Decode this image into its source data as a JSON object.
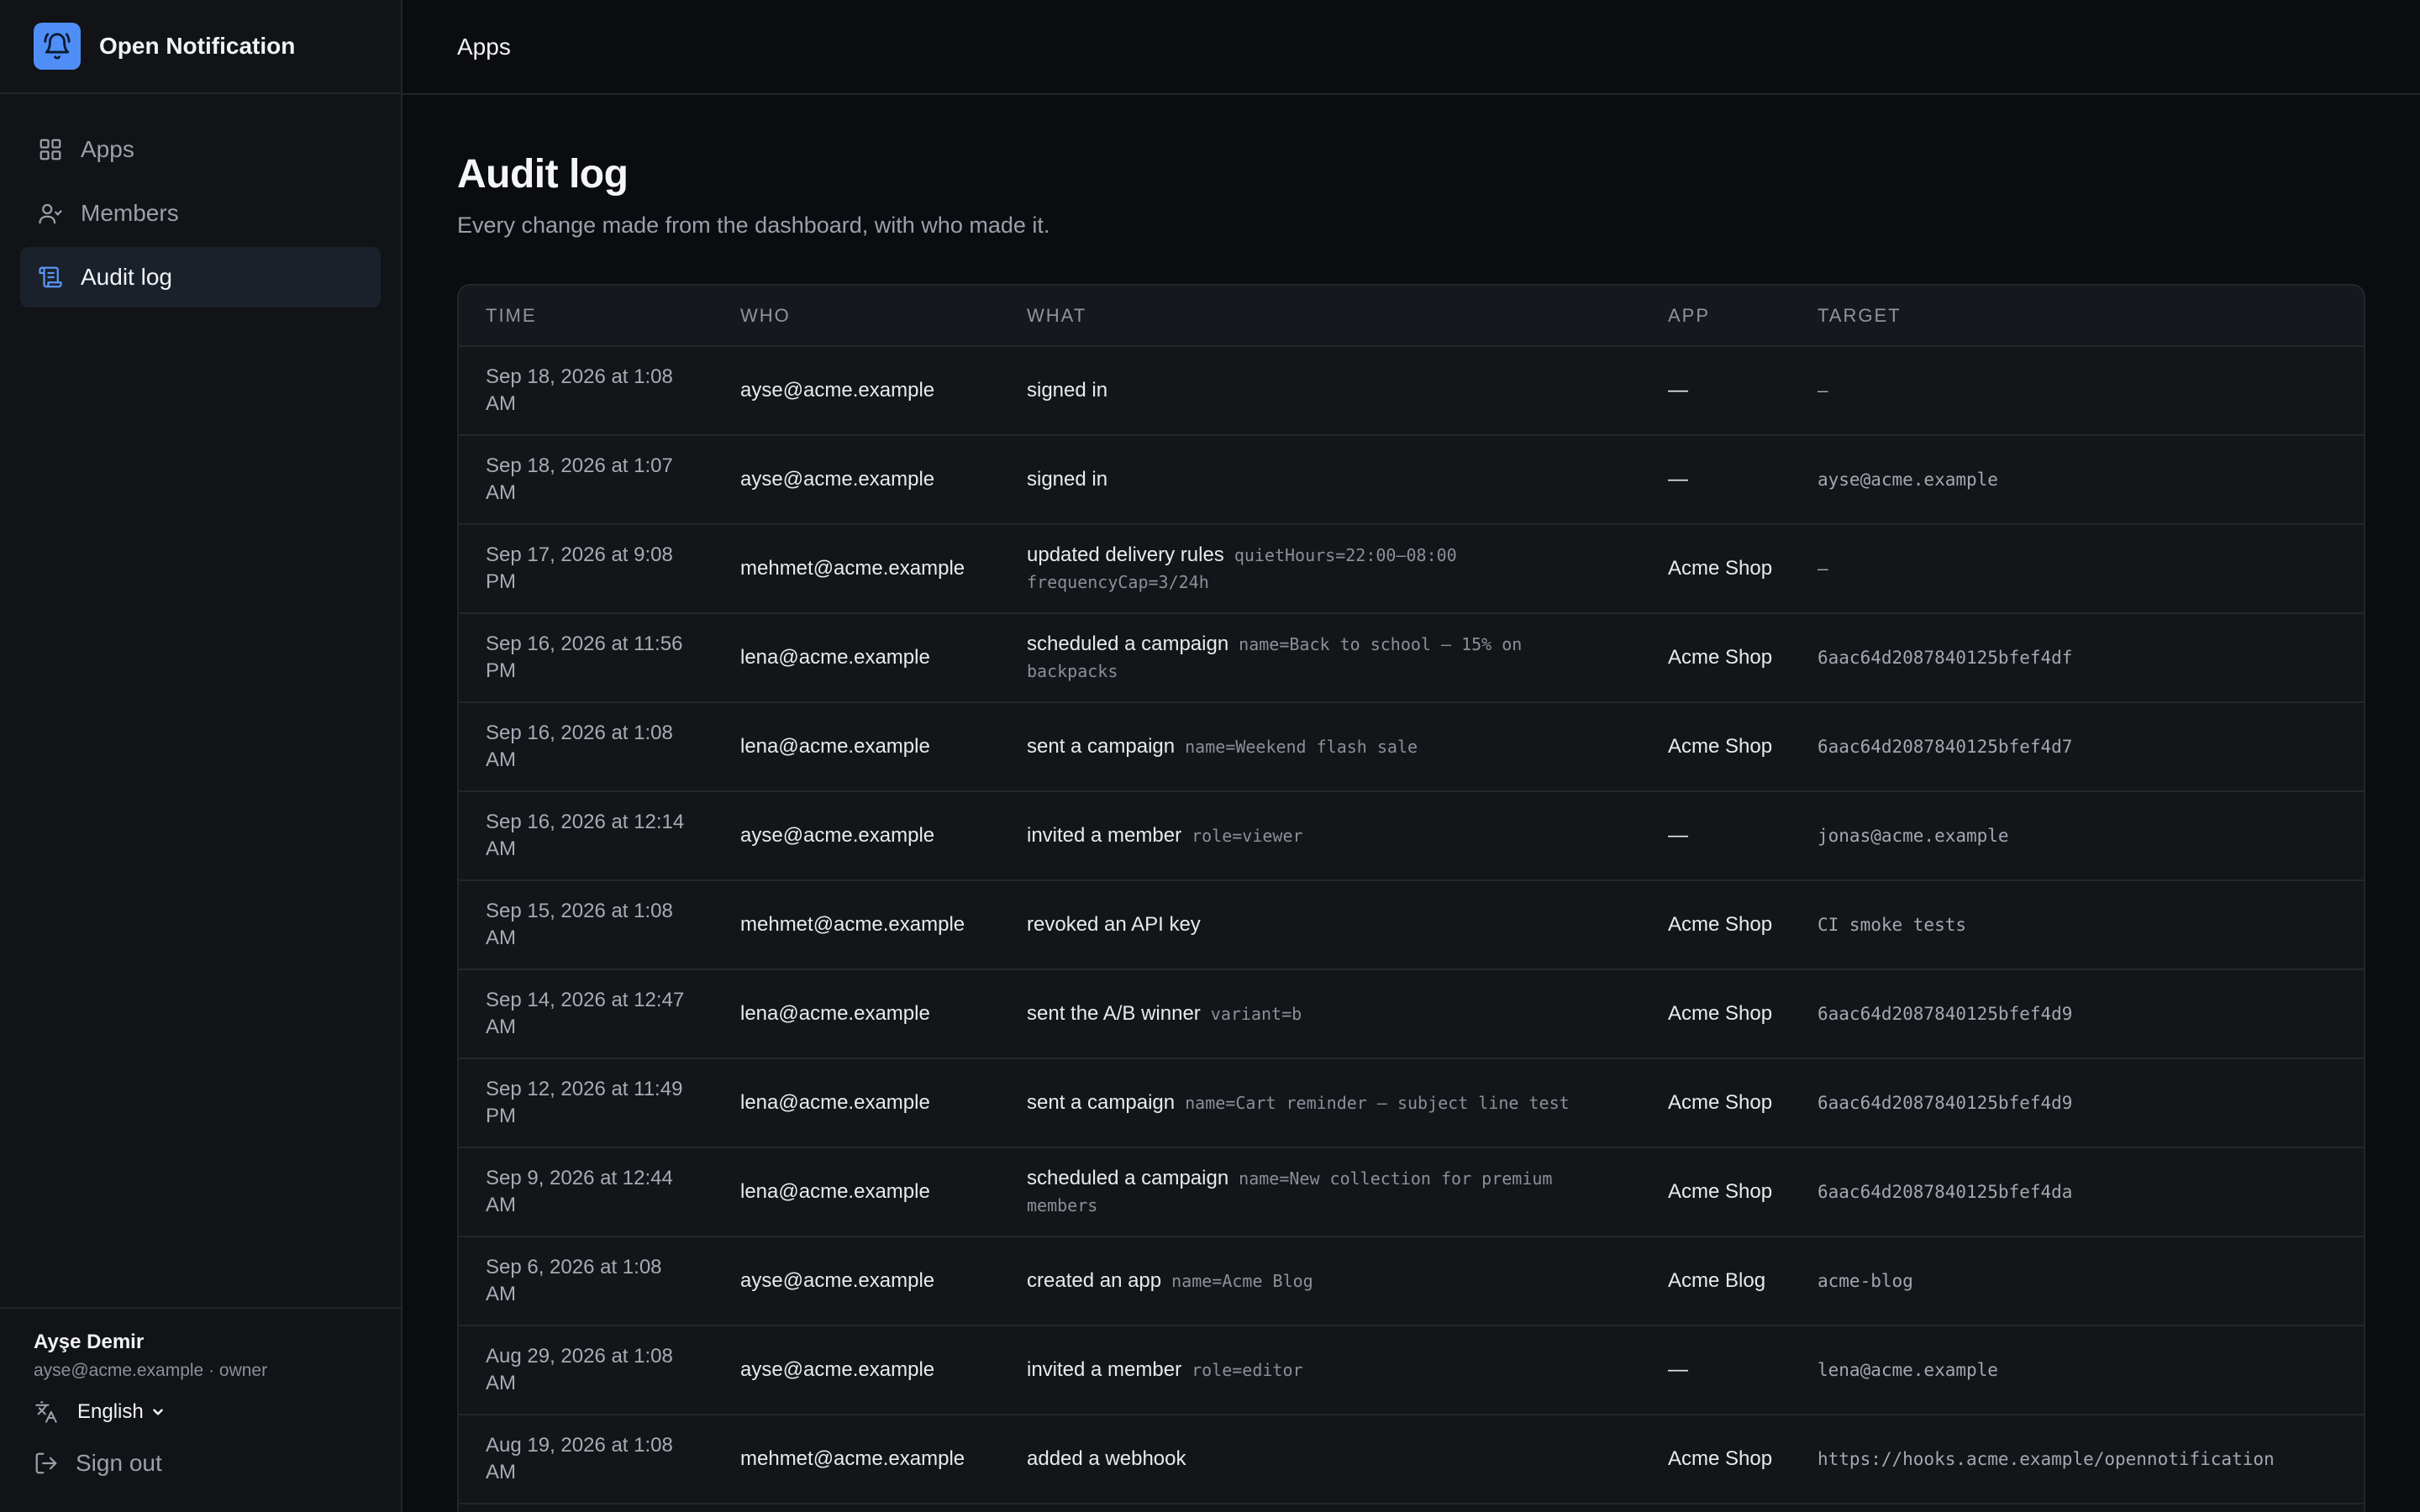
{
  "app": {
    "name": "Open Notification",
    "accent": "#4f8ef7"
  },
  "sidebar": {
    "items": [
      {
        "label": "Apps",
        "icon": "grid-icon",
        "active": false
      },
      {
        "label": "Members",
        "icon": "users-icon",
        "active": false
      },
      {
        "label": "Audit log",
        "icon": "scroll-icon",
        "active": true
      }
    ]
  },
  "user": {
    "name": "Ayşe Demir",
    "meta": "ayse@acme.example · owner"
  },
  "language": {
    "selected": "English"
  },
  "signout_label": "Sign out",
  "topbar": {
    "breadcrumb": "Apps"
  },
  "page": {
    "title": "Audit log",
    "subtitle": "Every change made from the dashboard, with who made it."
  },
  "table": {
    "columns": [
      "TIME",
      "WHO",
      "WHAT",
      "APP",
      "TARGET"
    ],
    "rows": [
      {
        "time": "Sep 18, 2026 at 1:08 AM",
        "who": "ayse@acme.example",
        "action": "signed in",
        "detail": "",
        "app": "—",
        "target": "—"
      },
      {
        "time": "Sep 18, 2026 at 1:07 AM",
        "who": "ayse@acme.example",
        "action": "signed in",
        "detail": "",
        "app": "—",
        "target": "ayse@acme.example"
      },
      {
        "time": "Sep 17, 2026 at 9:08 PM",
        "who": "mehmet@acme.example",
        "action": "updated delivery rules",
        "detail": "quietHours=22:00–08:00 frequencyCap=3/24h",
        "app": "Acme Shop",
        "target": "—"
      },
      {
        "time": "Sep 16, 2026 at 11:56 PM",
        "who": "lena@acme.example",
        "action": "scheduled a campaign",
        "detail": "name=Back to school — 15% on backpacks",
        "app": "Acme Shop",
        "target": "6aac64d2087840125bfef4df"
      },
      {
        "time": "Sep 16, 2026 at 1:08 AM",
        "who": "lena@acme.example",
        "action": "sent a campaign",
        "detail": "name=Weekend flash sale",
        "app": "Acme Shop",
        "target": "6aac64d2087840125bfef4d7"
      },
      {
        "time": "Sep 16, 2026 at 12:14 AM",
        "who": "ayse@acme.example",
        "action": "invited a member",
        "detail": "role=viewer",
        "app": "—",
        "target": "jonas@acme.example"
      },
      {
        "time": "Sep 15, 2026 at 1:08 AM",
        "who": "mehmet@acme.example",
        "action": "revoked an API key",
        "detail": "",
        "app": "Acme Shop",
        "target": "CI smoke tests"
      },
      {
        "time": "Sep 14, 2026 at 12:47 AM",
        "who": "lena@acme.example",
        "action": "sent the A/B winner",
        "detail": "variant=b",
        "app": "Acme Shop",
        "target": "6aac64d2087840125bfef4d9"
      },
      {
        "time": "Sep 12, 2026 at 11:49 PM",
        "who": "lena@acme.example",
        "action": "sent a campaign",
        "detail": "name=Cart reminder — subject line test",
        "app": "Acme Shop",
        "target": "6aac64d2087840125bfef4d9"
      },
      {
        "time": "Sep 9, 2026 at 12:44 AM",
        "who": "lena@acme.example",
        "action": "scheduled a campaign",
        "detail": "name=New collection for premium members",
        "app": "Acme Shop",
        "target": "6aac64d2087840125bfef4da"
      },
      {
        "time": "Sep 6, 2026 at 1:08 AM",
        "who": "ayse@acme.example",
        "action": "created an app",
        "detail": "name=Acme Blog",
        "app": "Acme Blog",
        "target": "acme-blog"
      },
      {
        "time": "Aug 29, 2026 at 1:08 AM",
        "who": "ayse@acme.example",
        "action": "invited a member",
        "detail": "role=editor",
        "app": "—",
        "target": "lena@acme.example"
      },
      {
        "time": "Aug 19, 2026 at 1:08 AM",
        "who": "mehmet@acme.example",
        "action": "added a webhook",
        "detail": "",
        "app": "Acme Shop",
        "target": "https://hooks.acme.example/opennotification"
      }
    ]
  }
}
